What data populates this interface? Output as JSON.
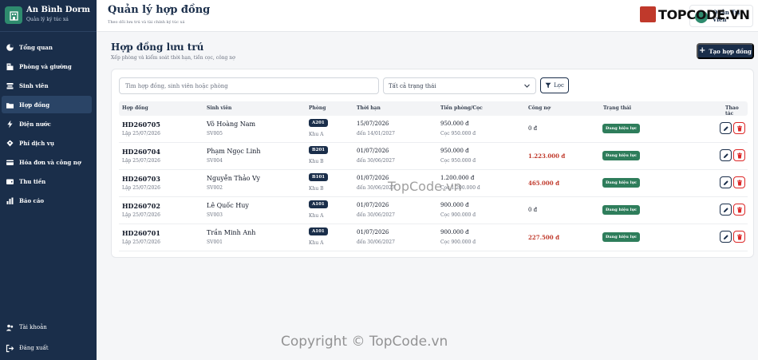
{
  "brand": {
    "name": "An Bình Dorm",
    "subtitle": "Quản lý ký túc xá"
  },
  "sidebar": {
    "items": [
      {
        "label": "Tổng quan",
        "icon": "dashboard-icon",
        "active": false
      },
      {
        "label": "Phòng và giường",
        "icon": "building-icon",
        "active": false
      },
      {
        "label": "Sinh viên",
        "icon": "student-icon",
        "active": false
      },
      {
        "label": "Hợp đồng",
        "icon": "contract-icon",
        "active": true
      },
      {
        "label": "Điện nước",
        "icon": "bolt-icon",
        "active": false
      },
      {
        "label": "Phí dịch vụ",
        "icon": "service-icon",
        "active": false
      },
      {
        "label": "Hóa đơn và công nợ",
        "icon": "invoice-icon",
        "active": false
      },
      {
        "label": "Thu tiền",
        "icon": "wallet-icon",
        "active": false
      },
      {
        "label": "Báo cáo",
        "icon": "chart-icon",
        "active": false
      }
    ],
    "bottom": [
      {
        "label": "Tài khoản",
        "icon": "users-icon"
      },
      {
        "label": "Đăng xuất",
        "icon": "logout-icon"
      }
    ]
  },
  "header": {
    "title": "Quản lý hợp đồng",
    "subtitle": "Theo dõi lưu trú và tài chính ký túc xá",
    "user_name": "Quản Trị Viên"
  },
  "main": {
    "title": "Hợp đồng lưu trú",
    "subtitle": "Xếp phòng và kiểm soát thời hạn, tiền cọc, công nợ",
    "create_label": "Tạo hợp đồng",
    "search_placeholder": "Tìm hợp đồng, sinh viên hoặc phòng",
    "status_filter": "Tất cả trạng thái",
    "filter_label": "Lọc"
  },
  "table": {
    "headers": [
      "Hợp đồng",
      "Sinh viên",
      "Phòng",
      "Thời hạn",
      "Tiền phòng/Cọc",
      "Công nợ",
      "Trạng thái",
      "Thao tác"
    ],
    "rows": [
      {
        "code": "HD260705",
        "created": "Lập 25/07/2026",
        "student": "Võ Hoàng Nam",
        "sid": "SV005",
        "room": "A201",
        "area": "Khu A",
        "start": "15/07/2026",
        "end": "đến 14/01/2027",
        "fee": "950.000 đ",
        "deposit": "Cọc 950.000 đ",
        "debt": "0 đ",
        "debt_red": false,
        "status": "Đang hiệu lực"
      },
      {
        "code": "HD260704",
        "created": "Lập 25/07/2026",
        "student": "Phạm Ngọc Linh",
        "sid": "SV004",
        "room": "B201",
        "area": "Khu B",
        "start": "01/07/2026",
        "end": "đến 30/06/2027",
        "fee": "950.000 đ",
        "deposit": "Cọc 950.000 đ",
        "debt": "1.223.000 đ",
        "debt_red": true,
        "status": "Đang hiệu lực"
      },
      {
        "code": "HD260703",
        "created": "Lập 25/07/2026",
        "student": "Nguyễn Thảo Vy",
        "sid": "SV002",
        "room": "B101",
        "area": "Khu B",
        "start": "01/07/2026",
        "end": "đến 30/06/2027",
        "fee": "1.200.000 đ",
        "deposit": "Cọc 1.200.000 đ",
        "debt": "465.000 đ",
        "debt_red": true,
        "status": "Đang hiệu lực"
      },
      {
        "code": "HD260702",
        "created": "Lập 25/07/2026",
        "student": "Lê Quốc Huy",
        "sid": "SV003",
        "room": "A101",
        "area": "Khu A",
        "start": "01/07/2026",
        "end": "đến 30/06/2027",
        "fee": "900.000 đ",
        "deposit": "Cọc 900.000 đ",
        "debt": "0 đ",
        "debt_red": false,
        "status": "Đang hiệu lực"
      },
      {
        "code": "HD260701",
        "created": "Lập 25/07/2026",
        "student": "Trần Minh Anh",
        "sid": "SV001",
        "room": "A101",
        "area": "Khu A",
        "start": "01/07/2026",
        "end": "đến 30/06/2027",
        "fee": "900.000 đ",
        "deposit": "Cọc 900.000 đ",
        "debt": "227.500 đ",
        "debt_red": true,
        "status": "Đang hiệu lực"
      }
    ]
  },
  "watermarks": {
    "logo": "TOPCODE.VN",
    "center": "TopCode.vn",
    "bottom": "Copyright © TopCode.vn"
  },
  "colors": {
    "sidebar": "#1a2e4a",
    "accent": "#2e8b6e",
    "status_green": "#2e7d5b",
    "debt_red": "#c0392b"
  }
}
